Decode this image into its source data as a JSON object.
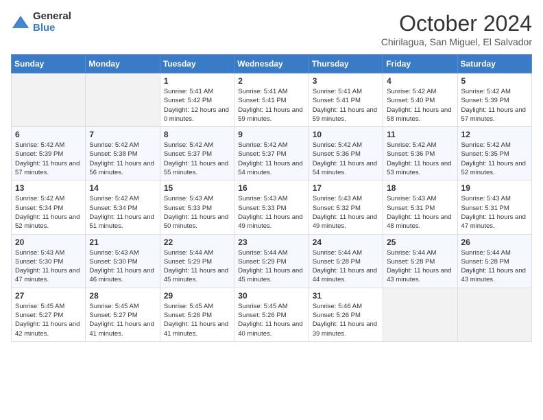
{
  "logo": {
    "general": "General",
    "blue": "Blue"
  },
  "title": "October 2024",
  "location": "Chirilagua, San Miguel, El Salvador",
  "weekdays": [
    "Sunday",
    "Monday",
    "Tuesday",
    "Wednesday",
    "Thursday",
    "Friday",
    "Saturday"
  ],
  "weeks": [
    [
      {
        "day": "",
        "info": ""
      },
      {
        "day": "",
        "info": ""
      },
      {
        "day": "1",
        "info": "Sunrise: 5:41 AM\nSunset: 5:42 PM\nDaylight: 12 hours\nand 0 minutes."
      },
      {
        "day": "2",
        "info": "Sunrise: 5:41 AM\nSunset: 5:41 PM\nDaylight: 11 hours\nand 59 minutes."
      },
      {
        "day": "3",
        "info": "Sunrise: 5:41 AM\nSunset: 5:41 PM\nDaylight: 11 hours\nand 59 minutes."
      },
      {
        "day": "4",
        "info": "Sunrise: 5:42 AM\nSunset: 5:40 PM\nDaylight: 11 hours\nand 58 minutes."
      },
      {
        "day": "5",
        "info": "Sunrise: 5:42 AM\nSunset: 5:39 PM\nDaylight: 11 hours\nand 57 minutes."
      }
    ],
    [
      {
        "day": "6",
        "info": "Sunrise: 5:42 AM\nSunset: 5:39 PM\nDaylight: 11 hours\nand 57 minutes."
      },
      {
        "day": "7",
        "info": "Sunrise: 5:42 AM\nSunset: 5:38 PM\nDaylight: 11 hours\nand 56 minutes."
      },
      {
        "day": "8",
        "info": "Sunrise: 5:42 AM\nSunset: 5:37 PM\nDaylight: 11 hours\nand 55 minutes."
      },
      {
        "day": "9",
        "info": "Sunrise: 5:42 AM\nSunset: 5:37 PM\nDaylight: 11 hours\nand 54 minutes."
      },
      {
        "day": "10",
        "info": "Sunrise: 5:42 AM\nSunset: 5:36 PM\nDaylight: 11 hours\nand 54 minutes."
      },
      {
        "day": "11",
        "info": "Sunrise: 5:42 AM\nSunset: 5:36 PM\nDaylight: 11 hours\nand 53 minutes."
      },
      {
        "day": "12",
        "info": "Sunrise: 5:42 AM\nSunset: 5:35 PM\nDaylight: 11 hours\nand 52 minutes."
      }
    ],
    [
      {
        "day": "13",
        "info": "Sunrise: 5:42 AM\nSunset: 5:34 PM\nDaylight: 11 hours\nand 52 minutes."
      },
      {
        "day": "14",
        "info": "Sunrise: 5:42 AM\nSunset: 5:34 PM\nDaylight: 11 hours\nand 51 minutes."
      },
      {
        "day": "15",
        "info": "Sunrise: 5:43 AM\nSunset: 5:33 PM\nDaylight: 11 hours\nand 50 minutes."
      },
      {
        "day": "16",
        "info": "Sunrise: 5:43 AM\nSunset: 5:33 PM\nDaylight: 11 hours\nand 49 minutes."
      },
      {
        "day": "17",
        "info": "Sunrise: 5:43 AM\nSunset: 5:32 PM\nDaylight: 11 hours\nand 49 minutes."
      },
      {
        "day": "18",
        "info": "Sunrise: 5:43 AM\nSunset: 5:31 PM\nDaylight: 11 hours\nand 48 minutes."
      },
      {
        "day": "19",
        "info": "Sunrise: 5:43 AM\nSunset: 5:31 PM\nDaylight: 11 hours\nand 47 minutes."
      }
    ],
    [
      {
        "day": "20",
        "info": "Sunrise: 5:43 AM\nSunset: 5:30 PM\nDaylight: 11 hours\nand 47 minutes."
      },
      {
        "day": "21",
        "info": "Sunrise: 5:43 AM\nSunset: 5:30 PM\nDaylight: 11 hours\nand 46 minutes."
      },
      {
        "day": "22",
        "info": "Sunrise: 5:44 AM\nSunset: 5:29 PM\nDaylight: 11 hours\nand 45 minutes."
      },
      {
        "day": "23",
        "info": "Sunrise: 5:44 AM\nSunset: 5:29 PM\nDaylight: 11 hours\nand 45 minutes."
      },
      {
        "day": "24",
        "info": "Sunrise: 5:44 AM\nSunset: 5:28 PM\nDaylight: 11 hours\nand 44 minutes."
      },
      {
        "day": "25",
        "info": "Sunrise: 5:44 AM\nSunset: 5:28 PM\nDaylight: 11 hours\nand 43 minutes."
      },
      {
        "day": "26",
        "info": "Sunrise: 5:44 AM\nSunset: 5:28 PM\nDaylight: 11 hours\nand 43 minutes."
      }
    ],
    [
      {
        "day": "27",
        "info": "Sunrise: 5:45 AM\nSunset: 5:27 PM\nDaylight: 11 hours\nand 42 minutes."
      },
      {
        "day": "28",
        "info": "Sunrise: 5:45 AM\nSunset: 5:27 PM\nDaylight: 11 hours\nand 41 minutes."
      },
      {
        "day": "29",
        "info": "Sunrise: 5:45 AM\nSunset: 5:26 PM\nDaylight: 11 hours\nand 41 minutes."
      },
      {
        "day": "30",
        "info": "Sunrise: 5:45 AM\nSunset: 5:26 PM\nDaylight: 11 hours\nand 40 minutes."
      },
      {
        "day": "31",
        "info": "Sunrise: 5:46 AM\nSunset: 5:26 PM\nDaylight: 11 hours\nand 39 minutes."
      },
      {
        "day": "",
        "info": ""
      },
      {
        "day": "",
        "info": ""
      }
    ]
  ]
}
